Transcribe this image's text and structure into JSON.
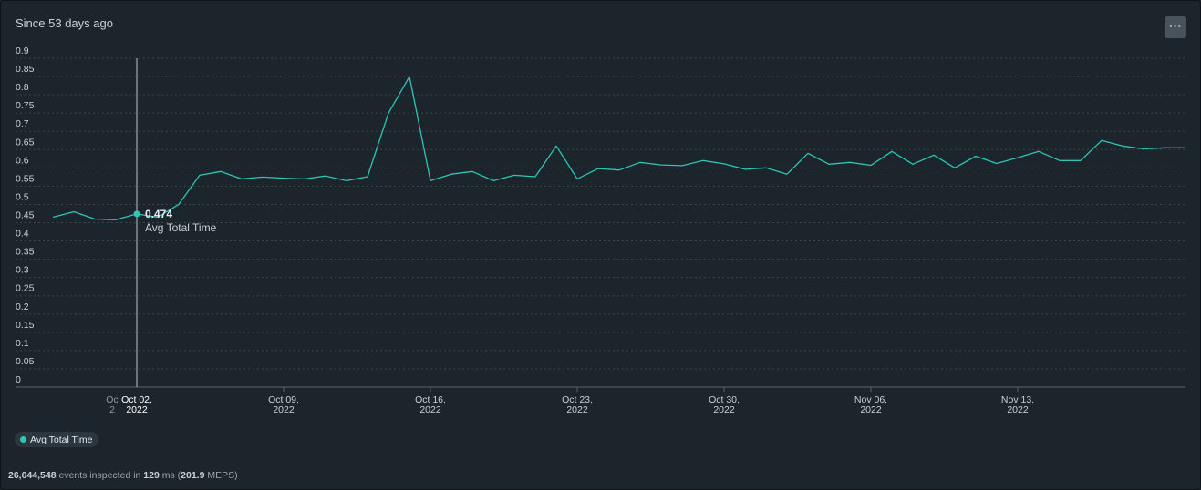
{
  "header": {
    "title": "Since 53 days ago",
    "more_label": "···"
  },
  "colors": {
    "series": "#2ec4b6",
    "grid": "#3a454d",
    "text": "#c9d1d6",
    "background": "#1d252c"
  },
  "tooltip": {
    "value": "0.474",
    "label": "Avg Total Time",
    "x_tick_line1": "Oct 02,",
    "x_tick_line2": "2022",
    "partial_tick_line1": "Oc",
    "partial_tick_line2": "2"
  },
  "legend": {
    "label": "Avg Total Time"
  },
  "footer": {
    "events": "26,044,548",
    "events_text": " events inspected in ",
    "ms": "129",
    "ms_text": " ms (",
    "meps": "201.9",
    "meps_text": " MEPS)"
  },
  "chart_data": {
    "type": "line",
    "ylim": [
      0,
      0.9
    ],
    "yticks": [
      0,
      0.05,
      0.1,
      0.15,
      0.2,
      0.25,
      0.3,
      0.35,
      0.4,
      0.45,
      0.5,
      0.55,
      0.6,
      0.65,
      0.7,
      0.75,
      0.8,
      0.85,
      0.9
    ],
    "xlim": [
      "2022-09-28",
      "2022-11-21"
    ],
    "xticks": [
      {
        "date": "2022-10-09",
        "line1": "Oct 09,",
        "line2": "2022"
      },
      {
        "date": "2022-10-16",
        "line1": "Oct 16,",
        "line2": "2022"
      },
      {
        "date": "2022-10-23",
        "line1": "Oct 23,",
        "line2": "2022"
      },
      {
        "date": "2022-10-30",
        "line1": "Oct 30,",
        "line2": "2022"
      },
      {
        "date": "2022-11-06",
        "line1": "Nov 06,",
        "line2": "2022"
      },
      {
        "date": "2022-11-13",
        "line1": "Nov 13,",
        "line2": "2022"
      }
    ],
    "grid": true,
    "legend_position": "bottom-left",
    "series": [
      {
        "name": "Avg Total Time",
        "x": [
          "2022-09-28",
          "2022-09-29",
          "2022-09-30",
          "2022-10-01",
          "2022-10-02",
          "2022-10-03",
          "2022-10-04",
          "2022-10-05",
          "2022-10-06",
          "2022-10-07",
          "2022-10-08",
          "2022-10-09",
          "2022-10-10",
          "2022-10-11",
          "2022-10-12",
          "2022-10-13",
          "2022-10-14",
          "2022-10-15",
          "2022-10-16",
          "2022-10-17",
          "2022-10-18",
          "2022-10-19",
          "2022-10-20",
          "2022-10-21",
          "2022-10-22",
          "2022-10-23",
          "2022-10-24",
          "2022-10-25",
          "2022-10-26",
          "2022-10-27",
          "2022-10-28",
          "2022-10-29",
          "2022-10-30",
          "2022-10-31",
          "2022-11-01",
          "2022-11-02",
          "2022-11-03",
          "2022-11-04",
          "2022-11-05",
          "2022-11-06",
          "2022-11-07",
          "2022-11-08",
          "2022-11-09",
          "2022-11-10",
          "2022-11-11",
          "2022-11-12",
          "2022-11-13",
          "2022-11-14",
          "2022-11-15",
          "2022-11-16",
          "2022-11-17",
          "2022-11-18",
          "2022-11-19",
          "2022-11-20",
          "2022-11-21"
        ],
        "values": [
          0.465,
          0.48,
          0.46,
          0.458,
          0.474,
          0.465,
          0.5,
          0.58,
          0.59,
          0.57,
          0.575,
          0.572,
          0.57,
          0.578,
          0.565,
          0.576,
          0.75,
          0.85,
          0.565,
          0.583,
          0.59,
          0.565,
          0.58,
          0.576,
          0.66,
          0.57,
          0.598,
          0.594,
          0.615,
          0.608,
          0.606,
          0.62,
          0.611,
          0.596,
          0.6,
          0.583,
          0.64,
          0.61,
          0.615,
          0.607,
          0.645,
          0.61,
          0.635,
          0.6,
          0.632,
          0.612,
          0.628,
          0.645,
          0.62,
          0.62,
          0.675,
          0.66,
          0.652,
          0.655,
          0.655
        ]
      }
    ]
  }
}
